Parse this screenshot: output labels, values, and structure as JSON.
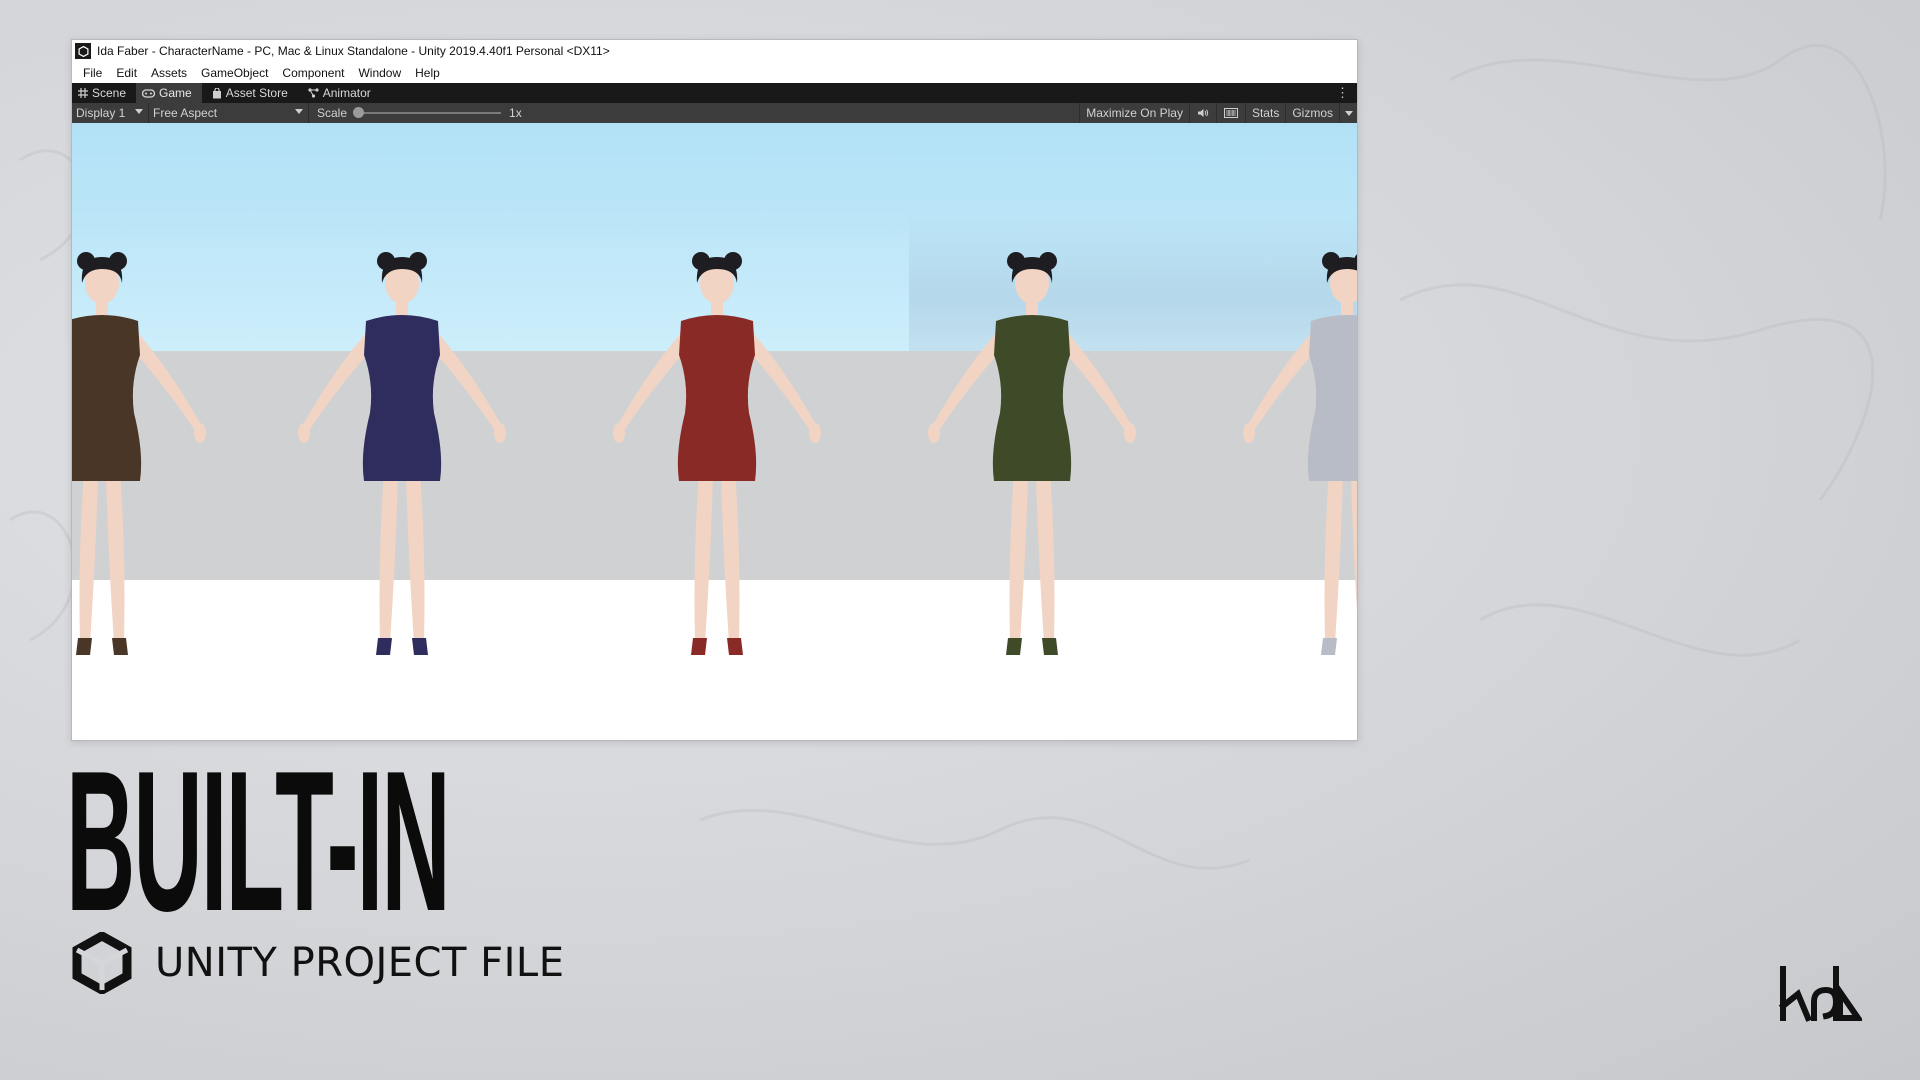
{
  "window": {
    "title": "Ida Faber - CharacterName - PC, Mac & Linux Standalone - Unity 2019.4.40f1 Personal <DX11>"
  },
  "menu": [
    "File",
    "Edit",
    "Assets",
    "GameObject",
    "Component",
    "Window",
    "Help"
  ],
  "tabs": [
    {
      "label": "Scene",
      "icon": "grid-icon"
    },
    {
      "label": "Game",
      "icon": "gamepad-icon"
    },
    {
      "label": "Asset Store",
      "icon": "store-icon"
    },
    {
      "label": "Animator",
      "icon": "animator-icon"
    }
  ],
  "game_toolbar": {
    "display": "Display 1",
    "aspect": "Free Aspect",
    "scale_label": "Scale",
    "scale_value": "1x",
    "maximize": "Maximize On Play",
    "stats": "Stats",
    "gizmos": "Gizmos"
  },
  "characters": [
    {
      "dress_color": "#4a3626"
    },
    {
      "dress_color": "#2f2c5e"
    },
    {
      "dress_color": "#8a2a26"
    },
    {
      "dress_color": "#3f4a28"
    },
    {
      "dress_color": "#b8bcc6"
    }
  ],
  "branding": {
    "headline": "BUILT-IN",
    "subtitle": "UNITY PROJECT FILE",
    "logo_icon": "ida-logo-icon",
    "unity_icon": "unity-logo-icon"
  }
}
